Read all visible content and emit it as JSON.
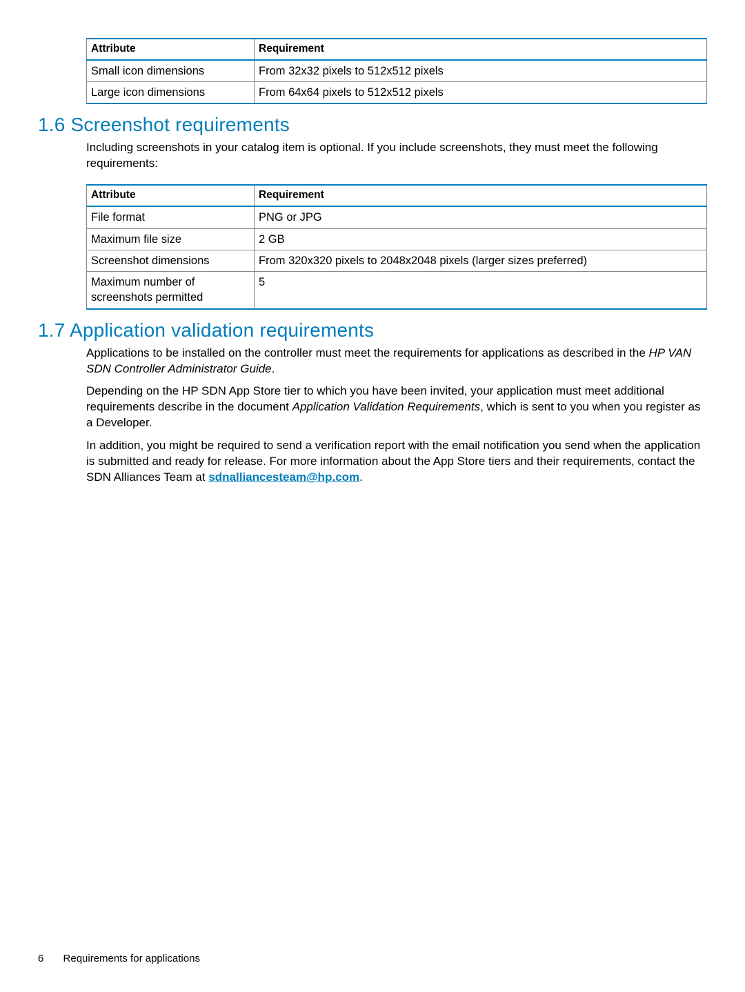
{
  "table1": {
    "headers": [
      "Attribute",
      "Requirement"
    ],
    "rows": [
      [
        "Small icon dimensions",
        "From 32x32 pixels to 512x512 pixels"
      ],
      [
        "Large icon dimensions",
        "From 64x64 pixels to 512x512 pixels"
      ]
    ]
  },
  "section16": {
    "heading": "1.6 Screenshot requirements",
    "intro": "Including screenshots in your catalog item is optional. If you include screenshots, they must meet the following requirements:"
  },
  "table2": {
    "headers": [
      "Attribute",
      "Requirement"
    ],
    "rows": [
      [
        "File format",
        "PNG or JPG"
      ],
      [
        "Maximum file size",
        "2 GB"
      ],
      [
        "Screenshot dimensions",
        "From 320x320 pixels to 2048x2048 pixels (larger sizes preferred)"
      ],
      [
        "Maximum number of screenshots permitted",
        "5"
      ]
    ]
  },
  "section17": {
    "heading": "1.7 Application validation requirements",
    "p1_a": "Applications to be installed on the controller must meet the requirements for applications as described in the ",
    "p1_i": "HP VAN SDN Controller Administrator Guide",
    "p1_b": ".",
    "p2_a": "Depending on the HP SDN App Store tier to which you have been invited, your application must meet additional requirements describe in the document ",
    "p2_i": "Application Validation Requirements",
    "p2_b": ", which is sent to you when you register as a Developer.",
    "p3_a": "In addition, you might be required to send a verification report with the email notification you send when the application is submitted and ready for release. For more information about the App Store tiers and their requirements, contact the SDN Alliances Team at ",
    "p3_link": "sdnalliancesteam@hp.com",
    "p3_b": "."
  },
  "footer": {
    "page_number": "6",
    "title": "Requirements for applications"
  }
}
